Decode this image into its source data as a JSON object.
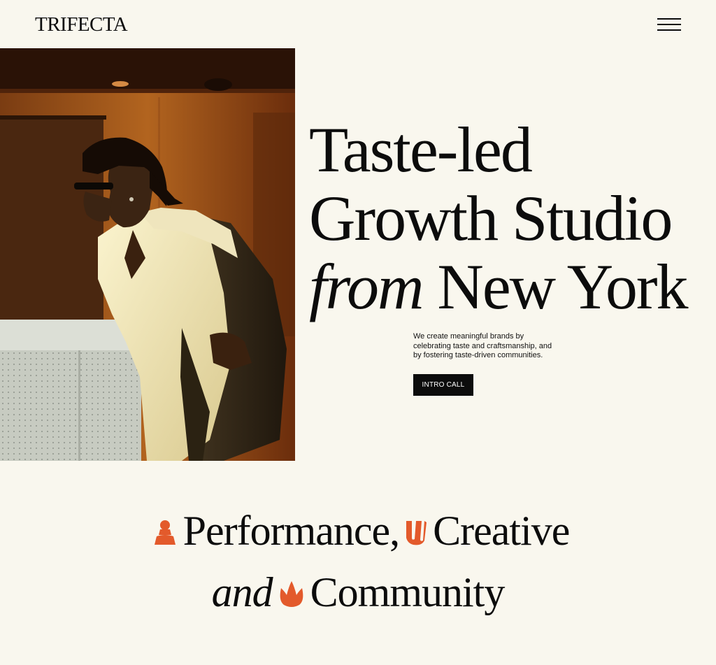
{
  "brand": {
    "logo_text": "TRIFECTA"
  },
  "nav": {
    "menu_icon": "hamburger-menu-icon"
  },
  "hero": {
    "headline": {
      "line1": "Taste-led",
      "line2": "Growth Studio",
      "line3_italic": "from",
      "line3_rest": " New York"
    },
    "description": "We create meaningful brands by celebrating taste and craftsmanship, and by fostering taste-driven communities.",
    "cta_label": "INTRO CALL",
    "image": "portrait-photo"
  },
  "pillars": {
    "word1": "Performance,",
    "word2": "Creative",
    "connector_italic": "and",
    "word3": "Community",
    "icons": [
      "chess-pawn-icon",
      "flag-icon",
      "crown-icon"
    ],
    "accent_color": "#e35a2b"
  },
  "colors": {
    "background": "#f9f7ee",
    "text": "#0c0c0c",
    "button_bg": "#0c0c0c",
    "button_text": "#ffffff",
    "accent": "#e35a2b"
  }
}
